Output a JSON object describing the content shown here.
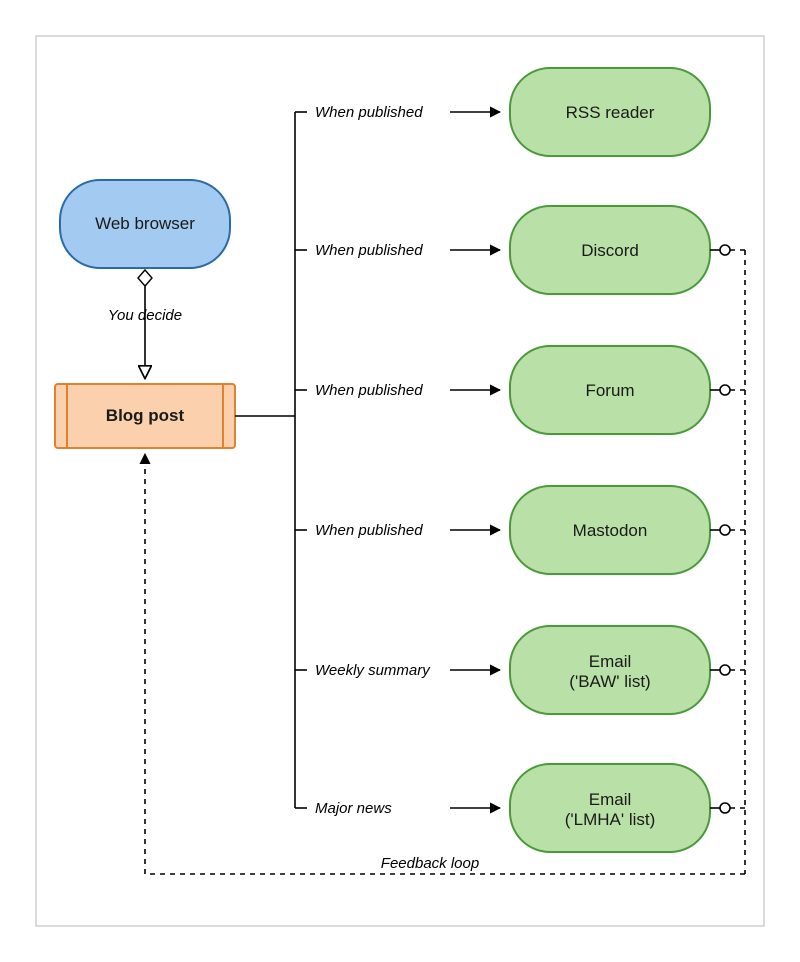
{
  "source_node": {
    "label": "Web browser"
  },
  "center_node": {
    "label": "Blog post"
  },
  "top_edge_label": "You decide",
  "feedback_label": "Feedback loop",
  "channels": [
    {
      "edge_label": "When published",
      "node_label": "RSS reader",
      "feedback": false
    },
    {
      "edge_label": "When published",
      "node_label": "Discord",
      "feedback": true
    },
    {
      "edge_label": "When published",
      "node_label": "Forum",
      "feedback": true
    },
    {
      "edge_label": "When published",
      "node_label": "Mastodon",
      "feedback": true
    },
    {
      "edge_label": "Weekly summary",
      "node_label": "Email\n('BAW' list)",
      "feedback": true
    },
    {
      "edge_label": "Major news",
      "node_label": "Email\n('LMHA' list)",
      "feedback": true
    }
  ]
}
